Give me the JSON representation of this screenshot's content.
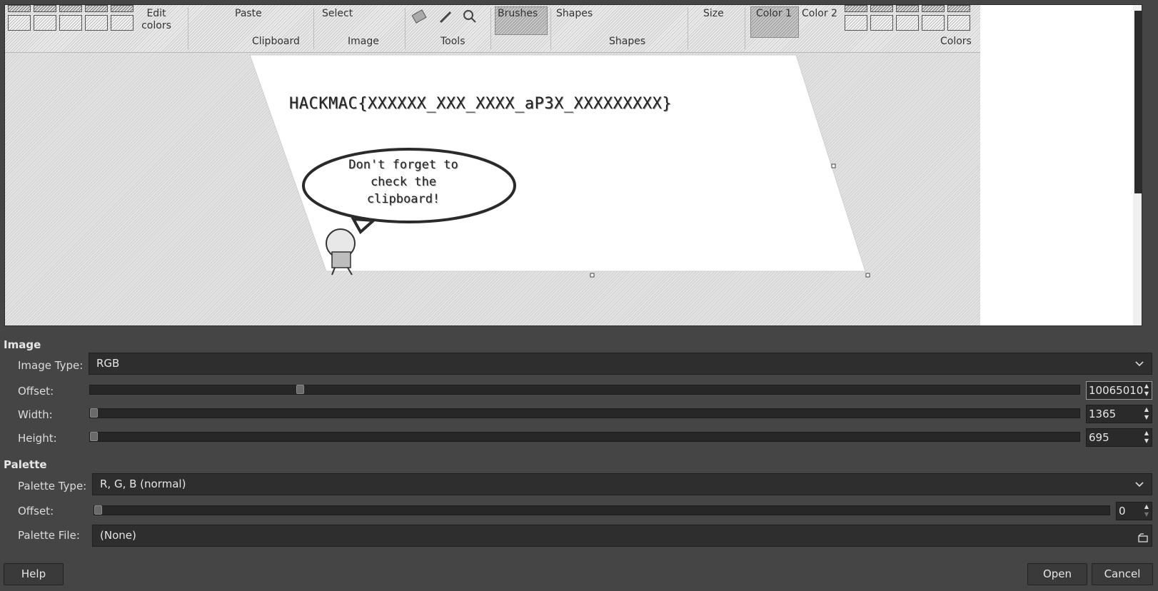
{
  "preview": {
    "ribbon": {
      "edit_colors": "Edit colors",
      "paste": "Paste",
      "select": "Select",
      "brushes": "Brushes",
      "shapes": "Shapes",
      "size": "Size",
      "color1": "Color 1",
      "color2": "Color 2",
      "groups": {
        "clipboard": "Clipboard",
        "image": "Image",
        "tools": "Tools",
        "shapes": "Shapes",
        "colors": "Colors"
      }
    },
    "canvas": {
      "flag_text": "HACKMAC{XXXXXX_XXX_XXXX_aP3X_XXXXXXXXX}",
      "speech_lines": [
        "Don't forget to",
        "check the",
        "clipboard!"
      ]
    }
  },
  "image_section": {
    "heading": "Image",
    "image_type_label": "Image Type:",
    "image_type_value": "RGB",
    "offset_label": "Offset:",
    "offset_value": "10065010",
    "offset_fraction": 0.21,
    "width_label": "Width:",
    "width_value": "1365",
    "width_fraction": 0.0,
    "height_label": "Height:",
    "height_value": "695",
    "height_fraction": 0.0
  },
  "palette_section": {
    "heading": "Palette",
    "palette_type_label": "Palette Type:",
    "palette_type_value": "R, G, B (normal)",
    "offset_label": "Offset:",
    "offset_value": "0",
    "offset_fraction": 0.0,
    "palette_file_label": "Palette File:",
    "palette_file_value": "(None)"
  },
  "buttons": {
    "help": "Help",
    "open": "Open",
    "cancel": "Cancel"
  },
  "icons": [
    "chevron-down-icon",
    "spin-up-icon",
    "spin-down-icon",
    "folder-open-icon",
    "pencil-icon",
    "color-picker-icon",
    "magnifier-icon"
  ]
}
